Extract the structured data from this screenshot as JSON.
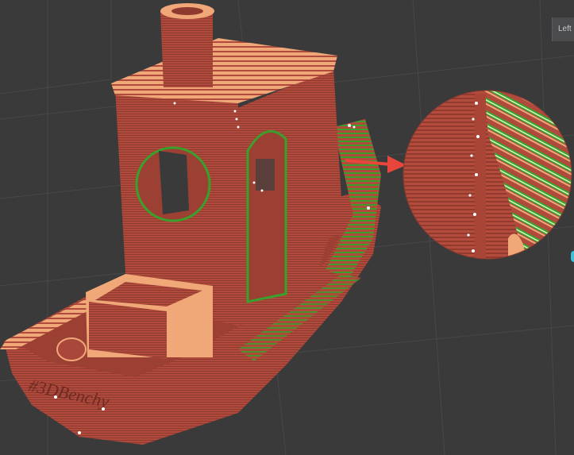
{
  "viewport": {
    "view_tab_label": "Left",
    "model": "3D Benchy",
    "colors": {
      "background": "#3a3a3b",
      "grid_line": "#474849",
      "model_wall": "#b04a3c",
      "model_wall_dark": "#8e3a2f",
      "model_top_infill": "#f0a878",
      "support_green": "#3aa02c",
      "seam_white": "#ffffff",
      "arrow": "#e8463c",
      "accent": "#3ec0d8"
    },
    "icons": [
      "arrow-right-icon"
    ]
  }
}
